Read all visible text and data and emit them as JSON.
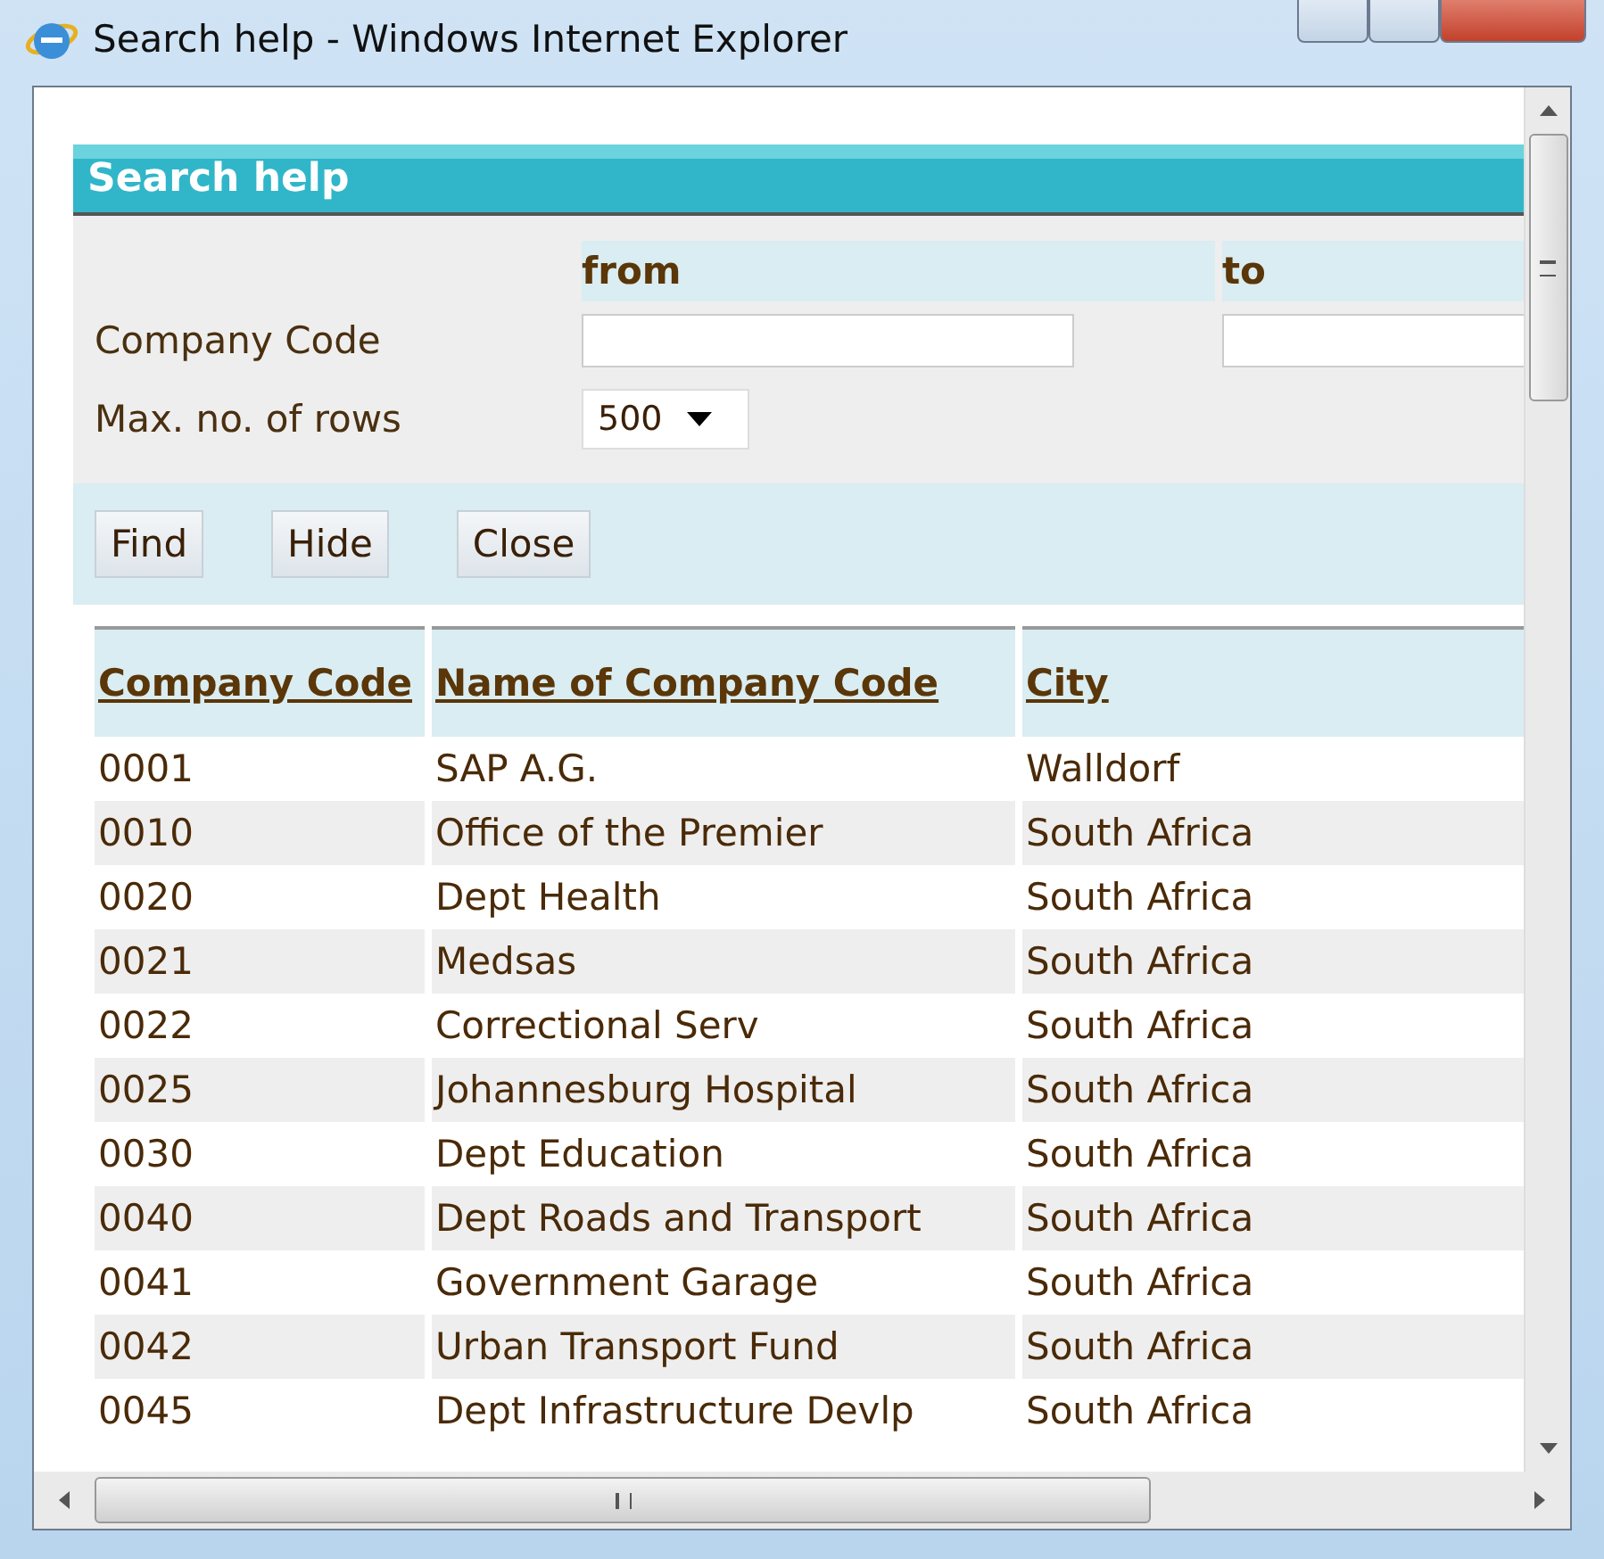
{
  "window": {
    "title": "Search help - Windows Internet Explorer"
  },
  "panel": {
    "title": "Search help",
    "range_headers": [
      "from",
      "to"
    ],
    "fields": [
      {
        "kind": "range",
        "label": "Company Code"
      },
      {
        "kind": "select",
        "label": "Max. no. of rows",
        "value": "500"
      }
    ],
    "buttons": [
      "Find",
      "Hide",
      "Close"
    ],
    "table": {
      "columns": [
        "Company Code",
        "Name of Company Code",
        "City"
      ],
      "rows": [
        [
          "0001",
          "SAP A.G.",
          "Walldorf"
        ],
        [
          "0010",
          "Office of the Premier",
          "South Africa"
        ],
        [
          "0020",
          "Dept Health",
          "South Africa"
        ],
        [
          "0021",
          "Medsas",
          "South Africa"
        ],
        [
          "0022",
          "Correctional Serv",
          "South Africa"
        ],
        [
          "0025",
          "Johannesburg Hospital",
          "South Africa"
        ],
        [
          "0030",
          "Dept Education",
          "South Africa"
        ],
        [
          "0040",
          "Dept Roads and Transport",
          "South Africa"
        ],
        [
          "0041",
          "Government Garage",
          "South Africa"
        ],
        [
          "0042",
          "Urban Transport Fund",
          "South Africa"
        ],
        [
          "0045",
          "Dept Infrastructure Devlp",
          "South Africa"
        ]
      ]
    }
  }
}
